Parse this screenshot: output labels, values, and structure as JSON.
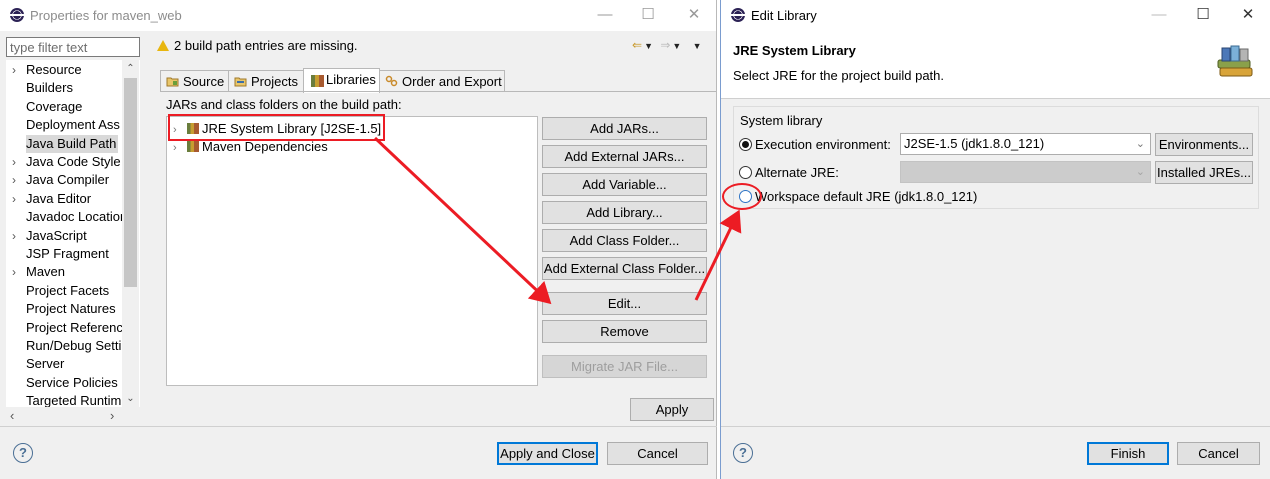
{
  "left_window": {
    "title": "Properties for maven_web",
    "filter_placeholder": "type filter text",
    "tree_items": [
      {
        "label": "Resource",
        "chevron": true
      },
      {
        "label": "Builders",
        "chevron": false
      },
      {
        "label": "Coverage",
        "chevron": false
      },
      {
        "label": "Deployment Ass",
        "chevron": false
      },
      {
        "label": "Java Build Path",
        "chevron": false,
        "selected": true
      },
      {
        "label": "Java Code Style",
        "chevron": true
      },
      {
        "label": "Java Compiler",
        "chevron": true
      },
      {
        "label": "Java Editor",
        "chevron": true
      },
      {
        "label": "Javadoc Location",
        "chevron": false
      },
      {
        "label": "JavaScript",
        "chevron": true
      },
      {
        "label": "JSP Fragment",
        "chevron": false
      },
      {
        "label": "Maven",
        "chevron": true
      },
      {
        "label": "Project Facets",
        "chevron": false
      },
      {
        "label": "Project Natures",
        "chevron": false
      },
      {
        "label": "Project Referenc",
        "chevron": false
      },
      {
        "label": "Run/Debug Setti",
        "chevron": false
      },
      {
        "label": "Server",
        "chevron": false
      },
      {
        "label": "Service Policies",
        "chevron": false
      },
      {
        "label": "Targeted Runtim",
        "chevron": false
      }
    ],
    "warning": "2 build path entries are missing.",
    "tabs": [
      "Source",
      "Projects",
      "Libraries",
      "Order and Export"
    ],
    "active_tab": "Libraries",
    "panel_label": "JARs and class folders on the build path:",
    "libraries": [
      "JRE System Library [J2SE-1.5]",
      "Maven Dependencies"
    ],
    "buttons": {
      "add_jars": "Add JARs...",
      "add_external_jars": "Add External JARs...",
      "add_variable": "Add Variable...",
      "add_library": "Add Library...",
      "add_class_folder": "Add Class Folder...",
      "add_external_class_folder": "Add External Class Folder...",
      "edit": "Edit...",
      "remove": "Remove",
      "migrate_jar": "Migrate JAR File...",
      "apply": "Apply",
      "apply_and_close": "Apply and Close",
      "cancel": "Cancel"
    }
  },
  "right_window": {
    "title": "Edit Library",
    "header_title": "JRE System Library",
    "header_desc": "Select JRE for the project build path.",
    "group_label": "System library",
    "exec_env_label": "Execution environment:",
    "exec_env_value": "J2SE-1.5 (jdk1.8.0_121)",
    "environments_button": "Environments...",
    "alternate_jre_label": "Alternate JRE:",
    "alternate_jre_value": "",
    "installed_jres_button": "Installed JREs...",
    "workspace_default_label": "Workspace default JRE (jdk1.8.0_121)",
    "selected_option": "execution_environment",
    "finish_button": "Finish",
    "cancel_button": "Cancel"
  },
  "annotation_color": "#ec1c24"
}
